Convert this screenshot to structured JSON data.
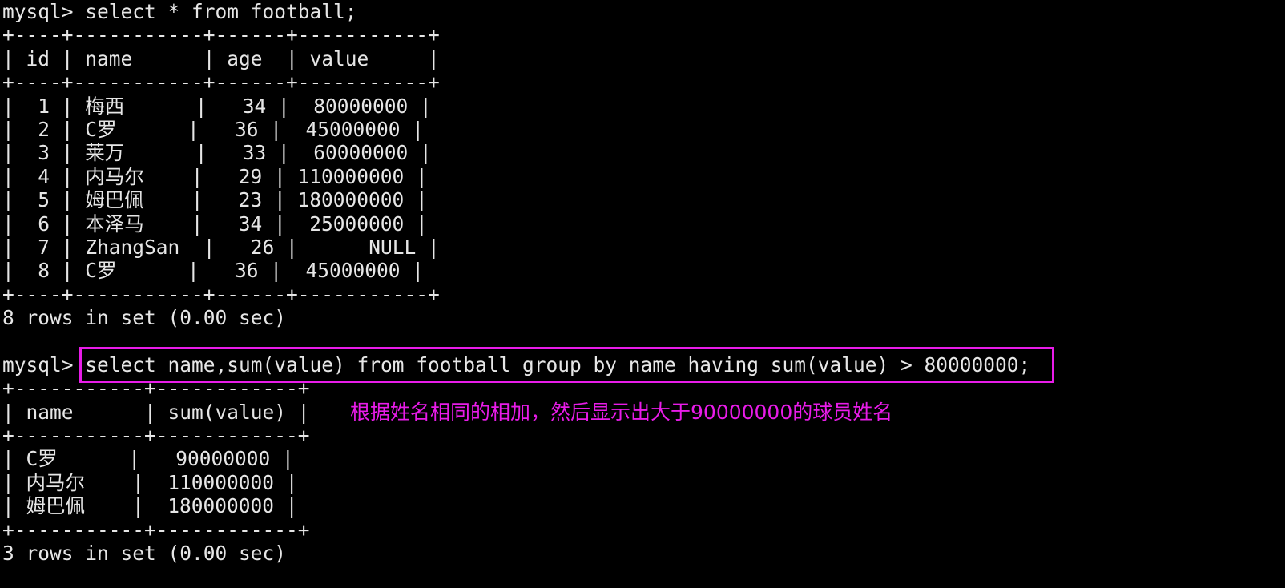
{
  "terminal": {
    "prompt": "mysql>",
    "background_color": "#000000",
    "text_color": "#e6e6e6",
    "highlight_color": "#e81ce8",
    "annotation_color": "#e81ce8"
  },
  "query1": {
    "prompt": "mysql>",
    "sql": " select * from football;"
  },
  "table1": {
    "separator": "+----+-----------+------+-----------+",
    "header": "| id | name      | age  | value     |",
    "columns": [
      "id",
      "name",
      "age",
      "value"
    ],
    "rows": [
      "|  1 | 梅西      |   34 |  80000000 |",
      "|  2 | C罗      |   36 |  45000000 |",
      "|  3 | 莱万      |   33 |  60000000 |",
      "|  4 | 内马尔    |   29 | 110000000 |",
      "|  5 | 姆巴佩    |   23 | 180000000 |",
      "|  6 | 本泽马    |   34 |  25000000 |",
      "|  7 | ZhangSan  |   26 |      NULL |",
      "|  8 | C罗      |   36 |  45000000 |"
    ],
    "data": [
      {
        "id": "1",
        "name": "梅西",
        "age": "34",
        "value": "80000000"
      },
      {
        "id": "2",
        "name": "C罗",
        "age": "36",
        "value": "45000000"
      },
      {
        "id": "3",
        "name": "莱万",
        "age": "33",
        "value": "60000000"
      },
      {
        "id": "4",
        "name": "内马尔",
        "age": "29",
        "value": "110000000"
      },
      {
        "id": "5",
        "name": "姆巴佩",
        "age": "23",
        "value": "180000000"
      },
      {
        "id": "6",
        "name": "本泽马",
        "age": "34",
        "value": "25000000"
      },
      {
        "id": "7",
        "name": "ZhangSan",
        "age": "26",
        "value": "NULL"
      },
      {
        "id": "8",
        "name": "C罗",
        "age": "36",
        "value": "45000000"
      }
    ],
    "footer": "8 rows in set (0.00 sec)"
  },
  "query2": {
    "prompt": "mysql>",
    "sql": " select name,sum(value) from football group by name having sum(value) > 80000000;"
  },
  "table2": {
    "separator": "+-----------+------------+",
    "header": "| name      | sum(value) |",
    "columns": [
      "name",
      "sum(value)"
    ],
    "rows": [
      "| C罗      |   90000000 |",
      "| 内马尔    |  110000000 |",
      "| 姆巴佩    |  180000000 |"
    ],
    "data": [
      {
        "name": "C罗",
        "sum_value": "90000000"
      },
      {
        "name": "内马尔",
        "sum_value": "110000000"
      },
      {
        "name": "姆巴佩",
        "sum_value": "180000000"
      }
    ],
    "footer": "3 rows in set (0.00 sec)"
  },
  "annotation": {
    "text": "根据姓名相同的相加，然后显示出大于90000000的球员姓名"
  }
}
